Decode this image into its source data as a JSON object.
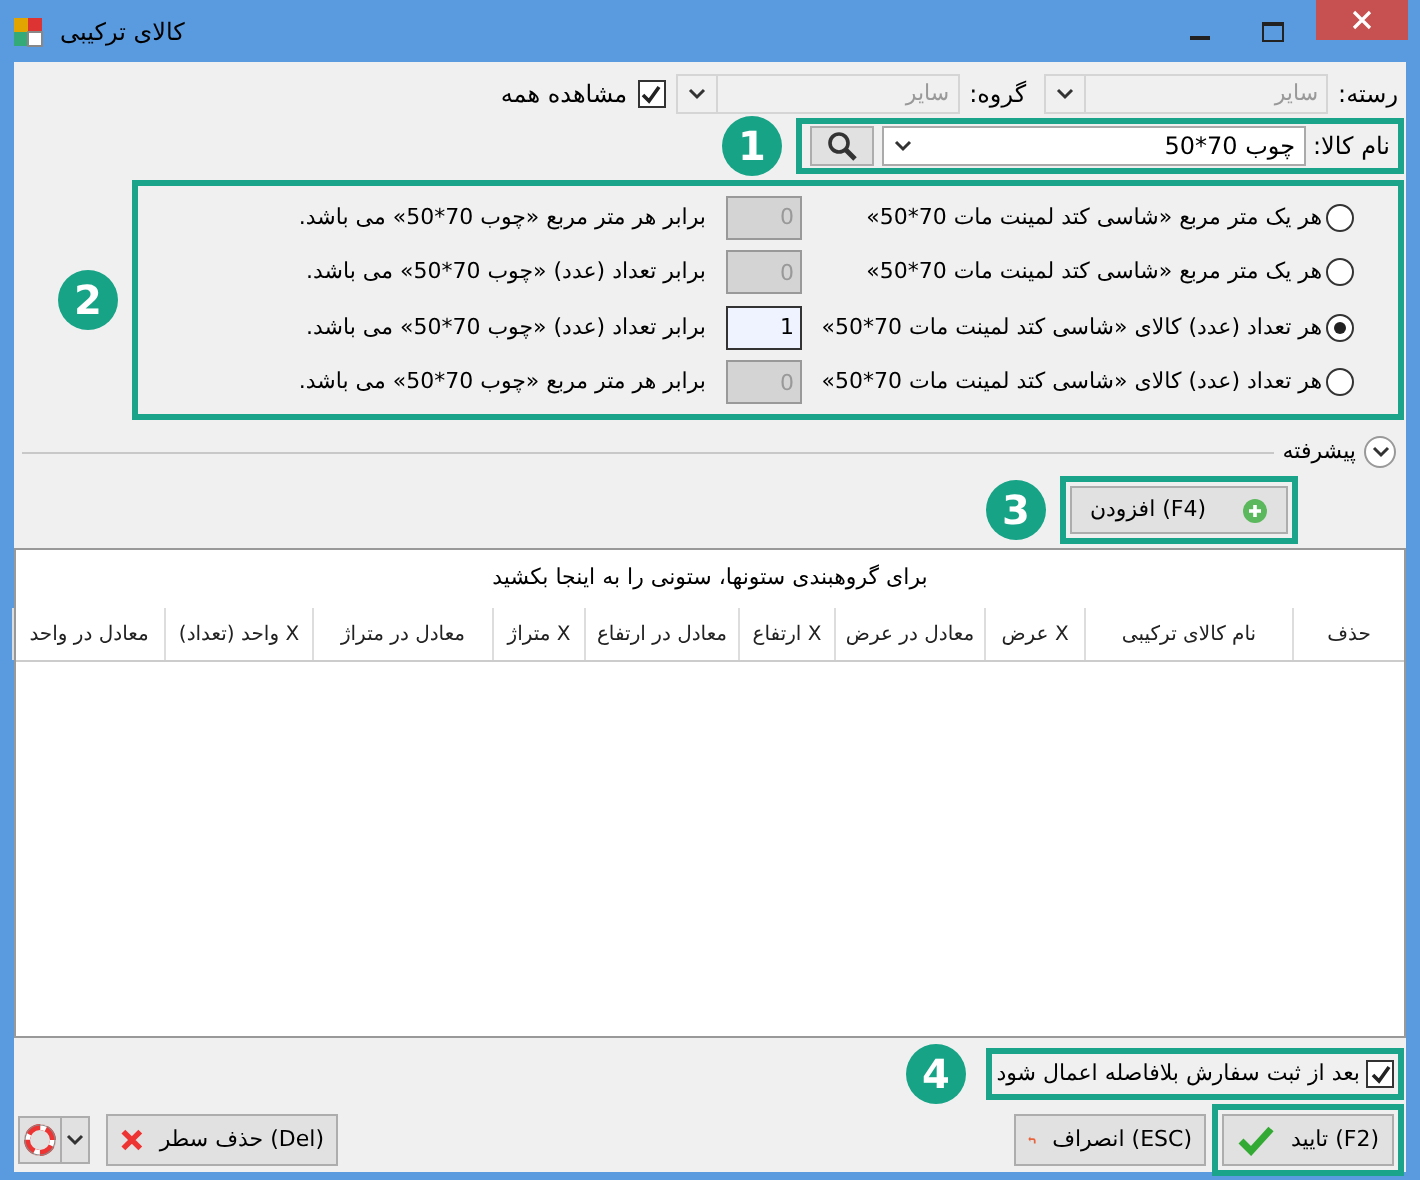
{
  "window": {
    "title": "کالای ترکیبی"
  },
  "filters": {
    "category_label": "رسته:",
    "category_value": "سایر",
    "group_label": "گروه:",
    "group_value": "سایر",
    "show_all": {
      "label": "مشاهده همه",
      "checked": true
    }
  },
  "product": {
    "label": "نام کالا:",
    "value": "چوب 70*50",
    "callout": "1"
  },
  "conversions": {
    "callout": "2",
    "options": [
      {
        "text": "هر یک متر مربع «شاسی کتد لمینت مات 70*50»",
        "selected": false,
        "value": "0",
        "result": "برابر هر متر مربع «چوب 70*50» می باشد."
      },
      {
        "text": "هر یک متر مربع «شاسی کتد لمینت مات 70*50»",
        "selected": false,
        "value": "0",
        "result": "برابر تعداد (عدد) «چوب 70*50» می باشد."
      },
      {
        "text": "هر تعداد (عدد) کالای «شاسی کتد لمینت مات 70*50»",
        "selected": true,
        "value": "1",
        "result": "برابر تعداد (عدد) «چوب 70*50» می باشد."
      },
      {
        "text": "هر تعداد (عدد) کالای «شاسی کتد لمینت مات 70*50»",
        "selected": false,
        "value": "0",
        "result": "برابر هر متر مربع «چوب 70*50» می باشد."
      }
    ]
  },
  "advanced": {
    "label": "پیشرفته",
    "expanded": false
  },
  "add_button": {
    "label": "(F4) افزودن",
    "callout": "3"
  },
  "grid": {
    "group_hint": "برای گروهبندی ستونها، ستونی را به اینجا بکشید",
    "columns": [
      "حذف",
      "نام کالای ترکیبی",
      "X عرض",
      "معادل در عرض",
      "X ارتفاع",
      "معادل در ارتفاع",
      "X متراژ",
      "معادل در متراژ",
      "X واحد (تعداد)",
      "معادل در واحد"
    ]
  },
  "apply_immediately": {
    "label": "بعد از ثبت سفارش بلافاصله اعمال شود",
    "checked": true,
    "callout": "4"
  },
  "buttons": [
    {
      "kind": "confirm",
      "label": "(F2) تایید"
    },
    {
      "kind": "cancel",
      "label": "(ESC) انصراف"
    },
    {
      "kind": "delete",
      "label": "(Del) حذف سطر"
    },
    {
      "kind": "help"
    }
  ]
}
